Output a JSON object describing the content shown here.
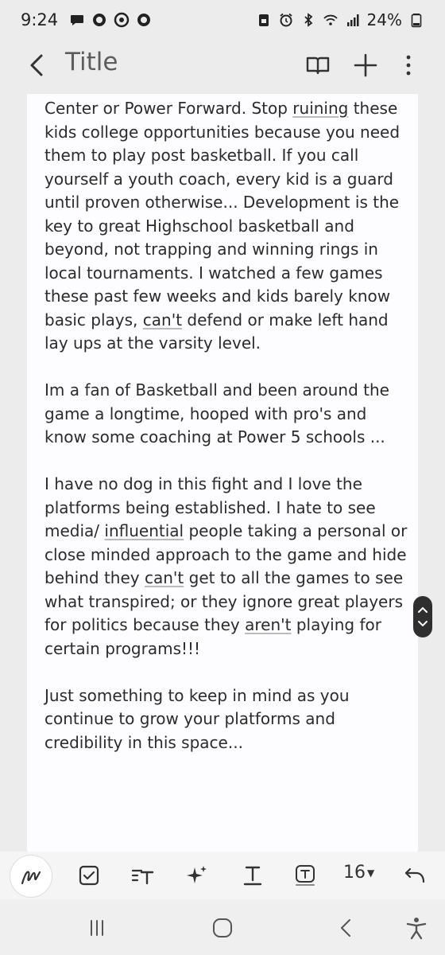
{
  "status_bar": {
    "time": "9:24",
    "battery_percent": "24%",
    "left_icons": [
      "chat-bubble-icon",
      "record-icon",
      "chrome-icon",
      "record-icon"
    ],
    "right_icons": [
      "save-icon",
      "alarm-icon",
      "bluetooth-icon",
      "wifi-icon",
      "signal-icon",
      "battery-icon"
    ]
  },
  "app_bar": {
    "title": "Title"
  },
  "note": {
    "paragraphs": [
      [
        {
          "t": "Center or Power Forward. Stop "
        },
        {
          "t": "ruining",
          "u": true
        },
        {
          "t": " these kids college opportunities because you need them to play post basketball. If you call yourself a youth coach, every kid is a guard until proven otherwise... Development is the key to great Highschool basketball and beyond, not trapping and winning rings in local tournaments. I watched a few games these past few weeks and kids barely know basic plays, "
        },
        {
          "t": "can't",
          "u": true
        },
        {
          "t": " defend or make left hand lay ups at the varsity level."
        }
      ],
      [
        {
          "t": "Im a fan of Basketball and been around the game a longtime, hooped with pro's and know some coaching at Power 5 schools ..."
        }
      ],
      [
        {
          "t": "I have no dog in this fight and I love the platforms being established. I hate to see media/ "
        },
        {
          "t": "influential",
          "u": true
        },
        {
          "t": " people taking a  personal or close minded approach to the game and hide behind they "
        },
        {
          "t": "can't",
          "u": true
        },
        {
          "t": " get to all the games to see what transpired; or they ignore great players for politics because they "
        },
        {
          "t": "aren't",
          "u": true
        },
        {
          "t": " playing for certain programs!!!"
        }
      ],
      [
        {
          "t": "Just something to keep in mind as you continue to grow your platforms and credibility in this space..."
        }
      ]
    ]
  },
  "toolbar": {
    "font_size": "16"
  },
  "colors": {
    "background": "#ececec",
    "note_background": "#fdfcfe",
    "title_gray": "#5d5d5d",
    "scroll_handle": "#2f2f2f"
  }
}
